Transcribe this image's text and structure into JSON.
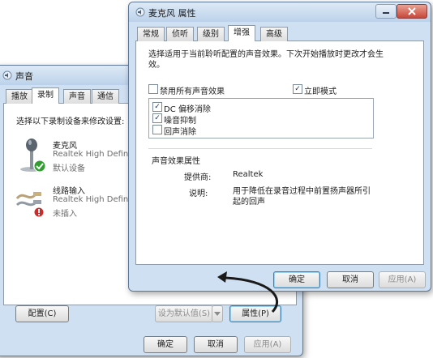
{
  "sound_dialog": {
    "title": "声音",
    "tabs": [
      "播放",
      "录制",
      "声音",
      "通信"
    ],
    "active_tab": "录制",
    "instruction": "选择以下录制设备来修改设置:",
    "devices": [
      {
        "name": "麦克风",
        "driver": "Realtek High Defin",
        "status": "默认设备",
        "icon": "microphone-icon",
        "badge": "check-icon"
      },
      {
        "name": "线路输入",
        "driver": "Realtek High Defin",
        "status": "未插入",
        "icon": "line-in-jack-icon",
        "badge": "unplugged-icon"
      }
    ],
    "configure_button": "配置(C)",
    "set_default_button": "设为默认值(S)",
    "properties_button": "属性(P)",
    "ok_button": "确定",
    "cancel_button": "取消",
    "apply_button": "应用(A)"
  },
  "mic_properties": {
    "title": "麦克风 属性",
    "tabs": [
      "常规",
      "侦听",
      "级别",
      "增强",
      "高级"
    ],
    "active_tab": "增强",
    "description": "选择适用于当前聆听配置的声音效果。下次开始播放时更改才会生效。",
    "disable_all_label": "禁用所有声音效果",
    "disable_all_checked": false,
    "immediate_mode_label": "立即模式",
    "immediate_mode_checked": true,
    "effects": [
      {
        "label": "DC 偏移消除",
        "checked": true
      },
      {
        "label": "噪音抑制",
        "checked": true
      },
      {
        "label": "回声消除",
        "checked": false
      }
    ],
    "effect_props_title": "声音效果属性",
    "provider_label": "提供商:",
    "provider_value": "Realtek",
    "desc_label": "说明:",
    "desc_value": "用于降低在录音过程中前置扬声器所引起的回声",
    "ok_button": "确定",
    "cancel_button": "取消",
    "apply_button": "应用(A)"
  },
  "window_controls": {
    "minimize": "minimize-icon",
    "close": "close-icon"
  },
  "colors": {
    "accent_border": "#3c7fb1",
    "check_green": "#2f9e2f",
    "unplugged_red": "#cc2b2b",
    "arrow": "#1a1a1a"
  }
}
